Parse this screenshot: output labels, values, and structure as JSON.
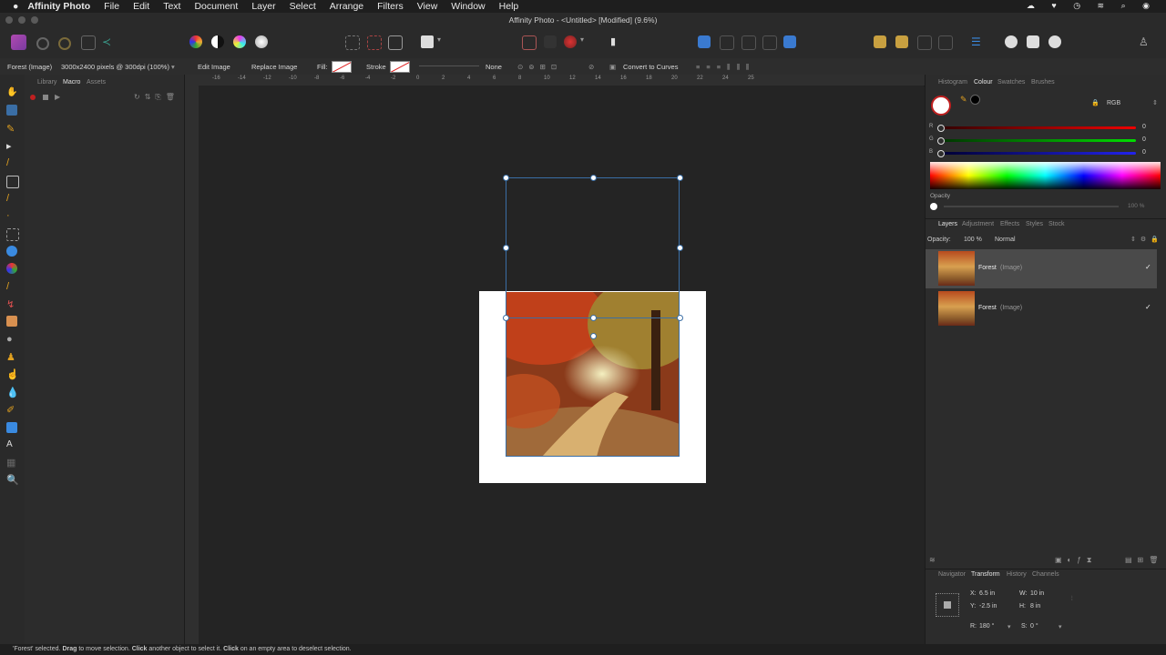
{
  "menubar": {
    "app_name": "Affinity Photo",
    "items": [
      "File",
      "Edit",
      "Text",
      "Document",
      "Layer",
      "Select",
      "Arrange",
      "Filters",
      "View",
      "Window",
      "Help"
    ]
  },
  "window": {
    "title": "Affinity Photo - <Untitled> [Modified] (9.6%)"
  },
  "context": {
    "layer_type": "Forest (Image)",
    "image_info": "3000x2400 pixels @ 300dpi (100%)",
    "edit_image": "Edit Image",
    "replace_image": "Replace Image",
    "fill_label": "Fill:",
    "stroke_label": "Stroke",
    "stroke_value": "None",
    "convert_curves": "Convert to Curves"
  },
  "left_panel": {
    "tabs": [
      "Library",
      "Macro",
      "Assets"
    ],
    "active": "Macro"
  },
  "right_top": {
    "tabs": [
      "Histogram",
      "Colour",
      "Swatches",
      "Brushes"
    ],
    "color_model": "RGB",
    "r_label": "R",
    "g_label": "G",
    "b_label": "B",
    "r": "0",
    "g": "0",
    "b": "0",
    "opacity_label": "Opacity",
    "opacity_value": "100 %"
  },
  "layers": {
    "tabs": [
      "Layers",
      "Adjustment",
      "Effects",
      "Styles",
      "Stock"
    ],
    "opacity_label": "Opacity:",
    "opacity_value": "100 %",
    "blend_mode": "Normal",
    "items": [
      {
        "name": "Forest",
        "type": "(Image)",
        "check": "✓"
      },
      {
        "name": "Forest",
        "type": "(Image)",
        "check": "✓"
      }
    ]
  },
  "transform": {
    "tabs": [
      "Navigator",
      "Transform",
      "History",
      "Channels"
    ],
    "x_label": "X:",
    "x": "6.5 in",
    "y_label": "Y:",
    "y": "-2.5 in",
    "w_label": "W:",
    "w": "10 in",
    "h_label": "H:",
    "h": "8 in",
    "r_label": "R:",
    "r": "180 °",
    "s_label": "S:",
    "s": "0 °"
  },
  "status": {
    "selected": "'Forest' selected.",
    "drag": "Drag",
    "drag_text": "to move selection.",
    "click": "Click",
    "click_text": "another object to select it.",
    "click2": "Click",
    "click2_text": "on an empty area to deselect selection."
  },
  "ruler_top_labels": [
    "-16",
    "-14",
    "-12",
    "-10",
    "-8",
    "-6",
    "-4",
    "-2",
    "0",
    "2",
    "4",
    "6",
    "8",
    "10",
    "12",
    "14",
    "16",
    "18",
    "20",
    "22",
    "24",
    "25"
  ],
  "colors": {
    "accent": "#3a6ea5",
    "selection": "#3a6ea5"
  }
}
